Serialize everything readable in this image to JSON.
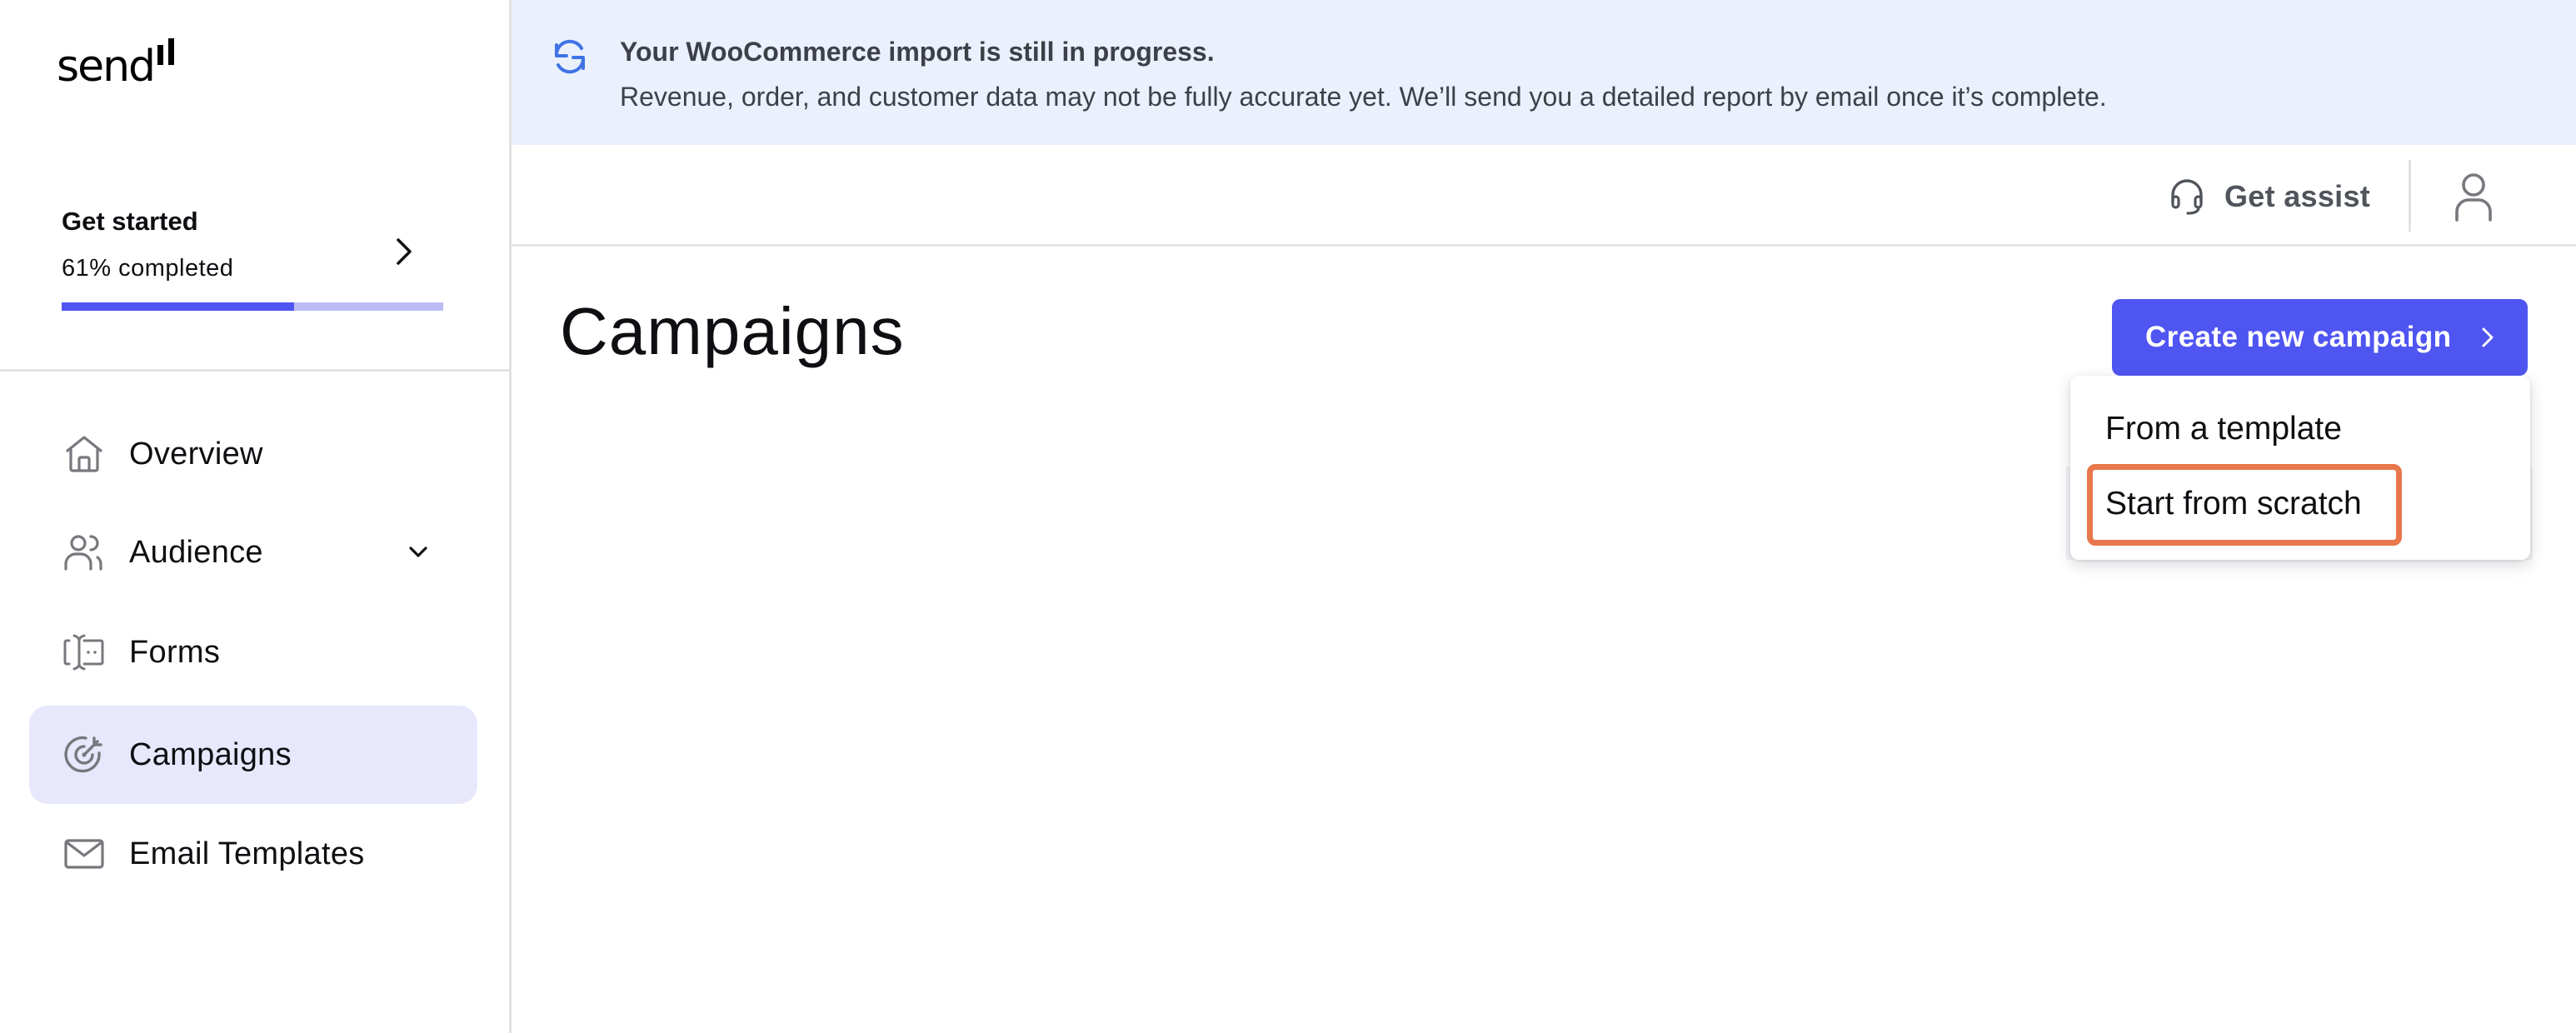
{
  "app": {
    "brand": "send",
    "accent_color": "#4f55f1"
  },
  "sidebar": {
    "get_started": {
      "title": "Get started",
      "progress_label": "61% completed",
      "progress_percent": 61
    },
    "items": [
      {
        "id": "overview",
        "label": "Overview",
        "icon": "home-icon",
        "active": false
      },
      {
        "id": "audience",
        "label": "Audience",
        "icon": "users-icon",
        "active": false,
        "expandable": true
      },
      {
        "id": "forms",
        "label": "Forms",
        "icon": "form-icon",
        "active": false
      },
      {
        "id": "campaigns",
        "label": "Campaigns",
        "icon": "target-icon",
        "active": true
      },
      {
        "id": "email-templates",
        "label": "Email Templates",
        "icon": "mail-icon",
        "active": false
      }
    ]
  },
  "banner": {
    "icon": "sync-icon",
    "title": "Your WooCommerce import is still in progress.",
    "message": "Revenue, order, and customer data may not be fully accurate yet. We’ll send you a detailed report by email once it’s complete."
  },
  "topbar": {
    "assist_label": "Get assist",
    "assist_icon": "headset-icon",
    "profile_icon": "user-icon"
  },
  "main": {
    "title": "Campaigns",
    "create_button_label": "Create new campaign",
    "create_menu": [
      {
        "label": "From a template",
        "highlighted": false
      },
      {
        "label": "Start from scratch",
        "highlighted": true
      }
    ],
    "highlight_color": "#e8774b"
  }
}
